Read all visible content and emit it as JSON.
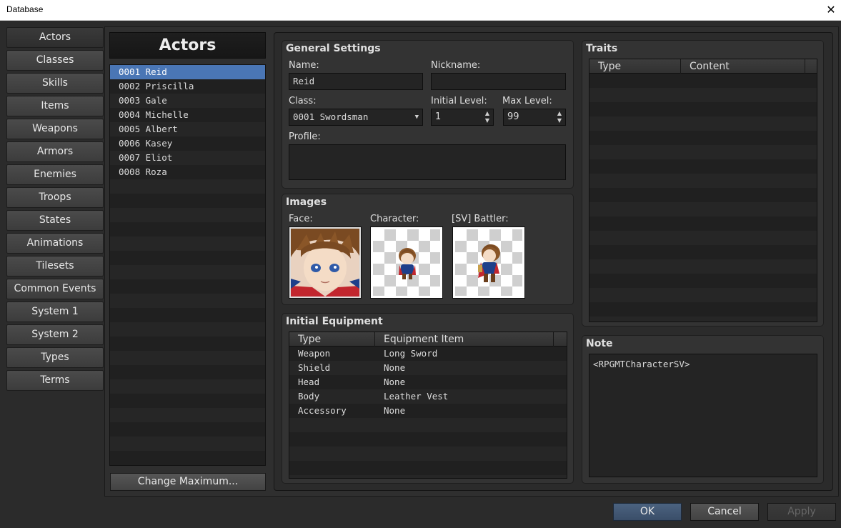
{
  "window": {
    "title": "Database",
    "close_glyph": "✕"
  },
  "nav": {
    "items": [
      "Actors",
      "Classes",
      "Skills",
      "Items",
      "Weapons",
      "Armors",
      "Enemies",
      "Troops",
      "States",
      "Animations",
      "Tilesets",
      "Common Events",
      "System 1",
      "System 2",
      "Types",
      "Terms"
    ],
    "active": "Actors"
  },
  "list": {
    "header": "Actors",
    "items": [
      "0001 Reid",
      "0002 Priscilla",
      "0003 Gale",
      "0004 Michelle",
      "0005 Albert",
      "0006 Kasey",
      "0007 Eliot",
      "0008 Roza"
    ],
    "selected_index": 0,
    "change_max_label": "Change Maximum..."
  },
  "general": {
    "title": "General Settings",
    "name_label": "Name:",
    "name_value": "Reid",
    "nickname_label": "Nickname:",
    "nickname_value": "",
    "class_label": "Class:",
    "class_value": "0001 Swordsman",
    "initial_level_label": "Initial Level:",
    "initial_level_value": "1",
    "max_level_label": "Max Level:",
    "max_level_value": "99",
    "profile_label": "Profile:",
    "profile_value": ""
  },
  "images": {
    "title": "Images",
    "face_label": "Face:",
    "character_label": "Character:",
    "battler_label": "[SV] Battler:"
  },
  "equipment": {
    "title": "Initial Equipment",
    "col_type": "Type",
    "col_item": "Equipment Item",
    "rows": [
      {
        "type": "Weapon",
        "item": "Long Sword"
      },
      {
        "type": "Shield",
        "item": "None"
      },
      {
        "type": "Head",
        "item": "None"
      },
      {
        "type": "Body",
        "item": "Leather Vest"
      },
      {
        "type": "Accessory",
        "item": "None"
      }
    ]
  },
  "traits": {
    "title": "Traits",
    "col_type": "Type",
    "col_content": "Content"
  },
  "note": {
    "title": "Note",
    "value": "<RPGMTCharacterSV>"
  },
  "buttons": {
    "ok": "OK",
    "cancel": "Cancel",
    "apply": "Apply"
  },
  "colors": {
    "selection": "#4a76b5",
    "background": "#2b2b2b",
    "panel": "#333333"
  }
}
